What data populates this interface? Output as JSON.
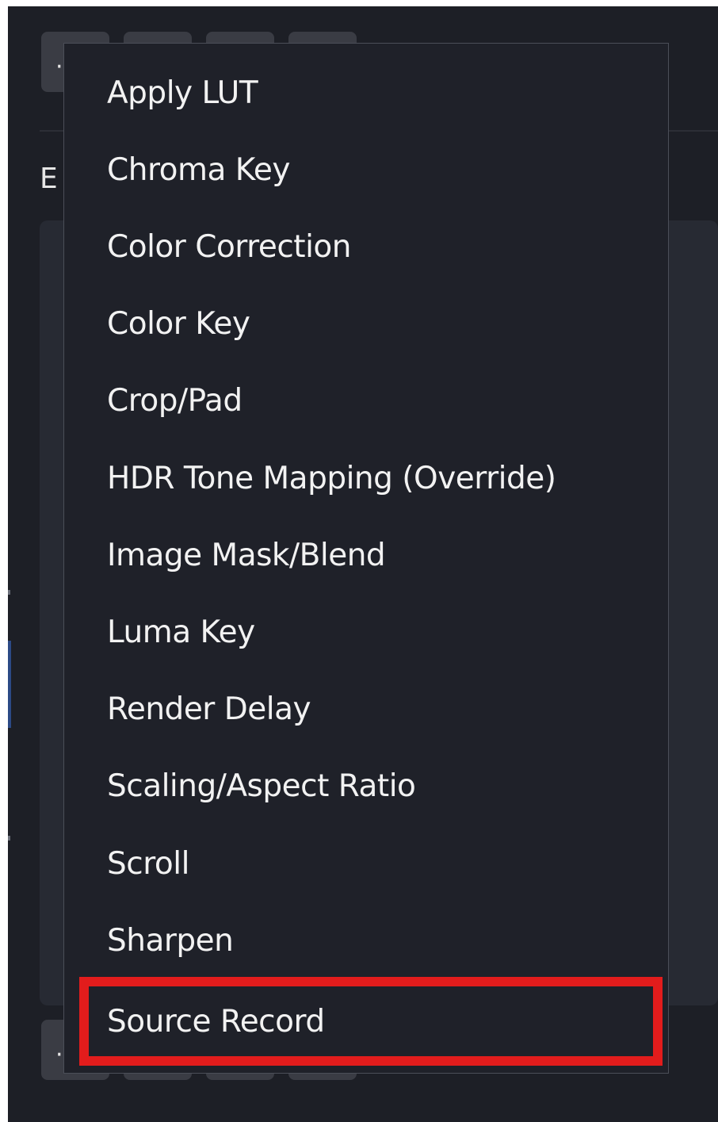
{
  "menu": {
    "items": [
      {
        "label": "Apply LUT"
      },
      {
        "label": "Chroma Key"
      },
      {
        "label": "Color Correction"
      },
      {
        "label": "Color Key"
      },
      {
        "label": "Crop/Pad"
      },
      {
        "label": "HDR Tone Mapping (Override)"
      },
      {
        "label": "Image Mask/Blend"
      },
      {
        "label": "Luma Key"
      },
      {
        "label": "Render Delay"
      },
      {
        "label": "Scaling/Aspect Ratio"
      },
      {
        "label": "Scroll"
      },
      {
        "label": "Sharpen"
      },
      {
        "label": "Source Record"
      }
    ],
    "highlighted_item": "Source Record",
    "highlight_color": "#e21c1c",
    "background_color": "#1f2129"
  },
  "background": {
    "section_label": "E",
    "toolbar_top_glyph": "·",
    "toolbar_bottom_glyph": "·",
    "toolbar_bottom_second_glyph": "□"
  }
}
